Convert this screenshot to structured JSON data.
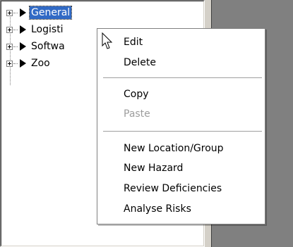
{
  "tree": {
    "items": [
      {
        "label": "General",
        "icon": "play-arrow-icon",
        "selected": true
      },
      {
        "label": "Logisti",
        "icon": "play-arrow-icon",
        "selected": false
      },
      {
        "label": "Softwa",
        "icon": "play-arrow-icon",
        "selected": false
      },
      {
        "label": "Zoo",
        "icon": "play-arrow-icon",
        "selected": false
      }
    ]
  },
  "context_menu": {
    "items": [
      {
        "label": "Edit",
        "enabled": true
      },
      {
        "label": "Delete",
        "enabled": true
      },
      {
        "label": "Copy",
        "enabled": true
      },
      {
        "label": "Paste",
        "enabled": false
      },
      {
        "label": "New Location/Group",
        "enabled": true
      },
      {
        "label": "New Hazard",
        "enabled": true
      },
      {
        "label": "Review Deficiencies",
        "enabled": true
      },
      {
        "label": "Analyse Risks",
        "enabled": true
      }
    ]
  },
  "colors": {
    "selection": "#316ac5",
    "panel_background": "#ffffff",
    "right_pane": "#808080",
    "disabled_text": "#9d9d9d"
  },
  "cursor": {
    "icon": "arrow-cursor-icon"
  }
}
